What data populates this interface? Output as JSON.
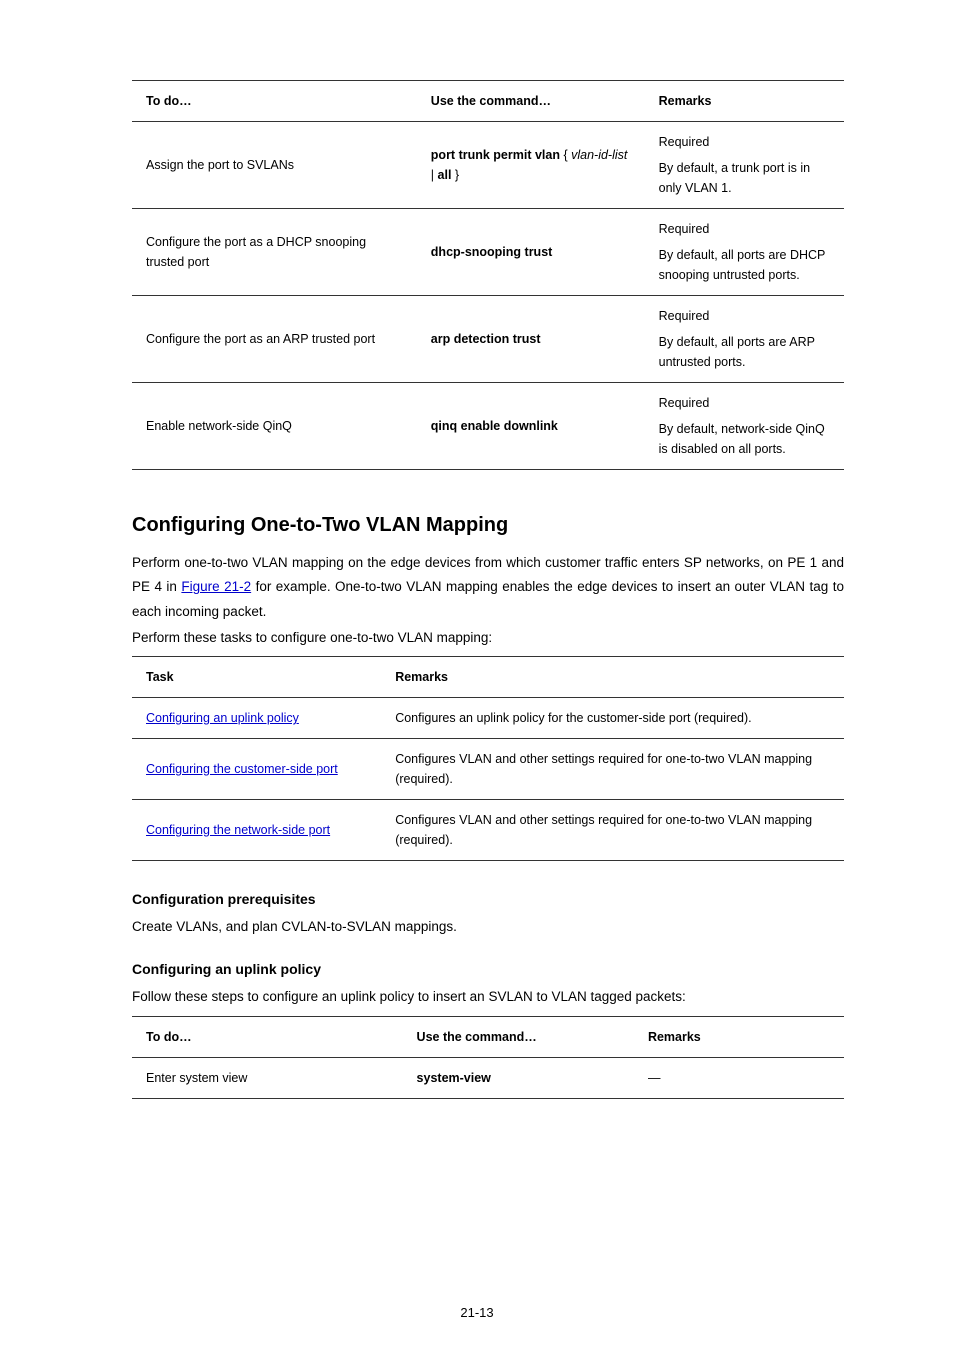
{
  "table1": {
    "header": {
      "c1": "To do…",
      "c2": "Use the command…",
      "c3": "Remarks"
    },
    "rows": [
      {
        "c1": "Assign the port to SVLANs",
        "c2_cmd": "port trunk permit vlan",
        "c2_open": " { ",
        "c2_arg": "vlan-id-list",
        "c2_sep": " | ",
        "c2_cmd2": "all",
        "c2_close": " }",
        "c3a": "Required",
        "c3b": "By default, a trunk port is in only VLAN 1."
      },
      {
        "c1": "Configure the port as a DHCP snooping trusted port",
        "c2_cmd": "dhcp-snooping trust",
        "c3a": "Required",
        "c3b": "By default, all ports are DHCP snooping untrusted ports."
      },
      {
        "c1": "Configure the port as an ARP trusted port",
        "c2_cmd": "arp detection trust",
        "c3a": "Required",
        "c3b": "By default, all ports are ARP untrusted ports."
      },
      {
        "c1": "Enable network-side QinQ",
        "c2_cmd": "qinq enable downlink",
        "c3a": "Required",
        "c3b": "By default, network-side QinQ is disabled on all ports."
      }
    ]
  },
  "section": {
    "heading": "Configuring One-to-Two VLAN Mapping",
    "p1_a": "Perform one-to-two VLAN mapping on the edge devices from which customer traffic enters SP networks, on PE 1 and PE 4 in ",
    "p1_link": "Figure 21-2",
    "p1_b": " for example. One-to-two VLAN mapping enables the edge devices to insert an outer VLAN tag to each incoming packet.",
    "p2": "Perform these tasks to configure one-to-two VLAN mapping:"
  },
  "table2": {
    "header": {
      "c1": "Task",
      "c2": "Remarks"
    },
    "rows": [
      {
        "link": "Configuring an uplink policy",
        "c2": "Configures an uplink policy for the customer-side port (required)."
      },
      {
        "link": "Configuring the customer-side port",
        "c2": "Configures VLAN and other settings required for one-to-two VLAN mapping (required)."
      },
      {
        "link": "Configuring the network-side port",
        "c2": "Configures VLAN and other settings required for one-to-two VLAN mapping (required)."
      }
    ]
  },
  "prereq": {
    "heading": "Configuration prerequisites",
    "body": "Create VLANs, and plan CVLAN-to-SVLAN mappings."
  },
  "uplink": {
    "heading": "Configuring an uplink policy",
    "body": "Follow these steps to configure an uplink policy to insert an SVLAN to VLAN tagged packets:"
  },
  "table3": {
    "header": {
      "c1": "To do…",
      "c2": "Use the command…",
      "c3": "Remarks"
    },
    "rows": [
      {
        "c1": "Enter system view",
        "c2": "system-view",
        "c3": "—"
      }
    ]
  },
  "pagenum": "21-13"
}
